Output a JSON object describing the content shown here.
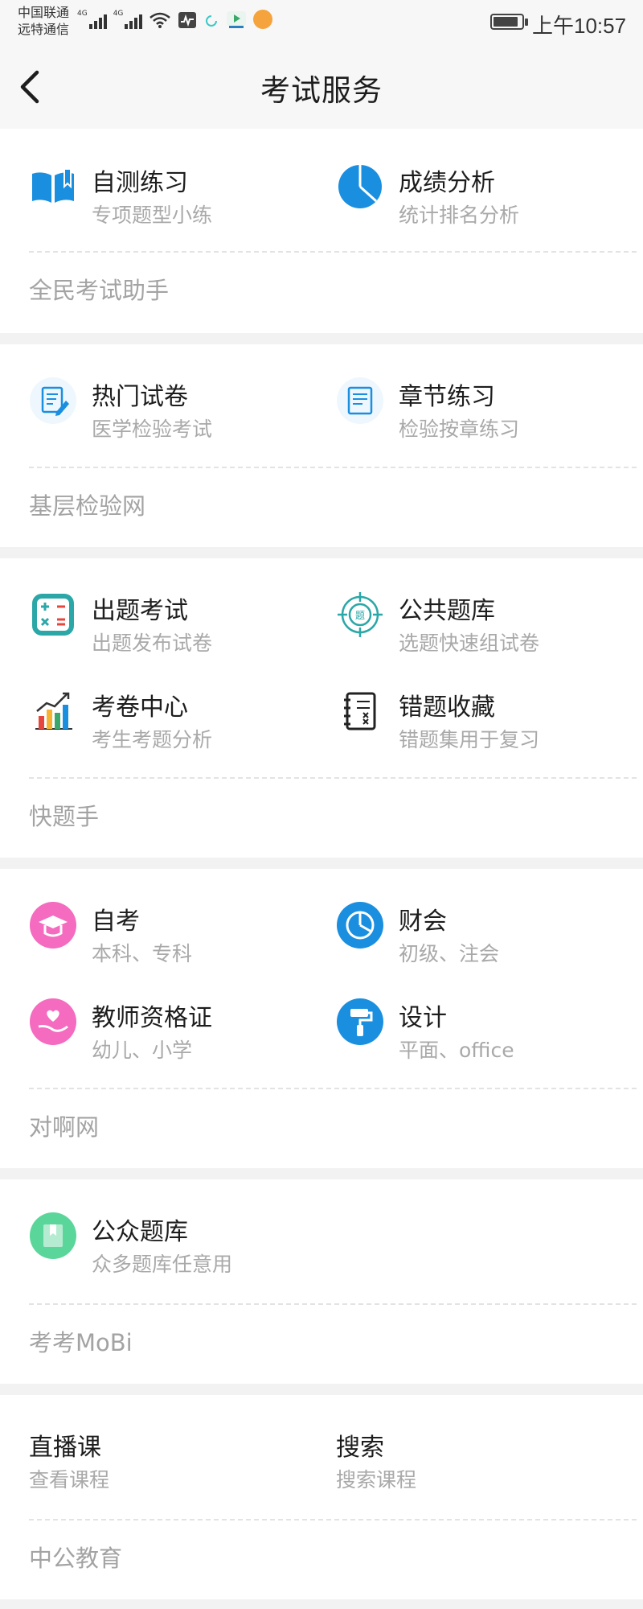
{
  "status_bar": {
    "carrier_line1": "中国联通",
    "carrier_line2": "远特通信",
    "net1": "4G",
    "net2": "4G",
    "time": "上午10:57"
  },
  "header": {
    "title": "考试服务"
  },
  "sections": [
    {
      "items": [
        {
          "title": "自测练习",
          "subtitle": "专项题型小练",
          "icon": "book-icon"
        },
        {
          "title": "成绩分析",
          "subtitle": "统计排名分析",
          "icon": "pie-chart-icon"
        }
      ],
      "provider": "全民考试助手"
    },
    {
      "items": [
        {
          "title": "热门试卷",
          "subtitle": "医学检验考试",
          "icon": "edit-document-icon"
        },
        {
          "title": "章节练习",
          "subtitle": "检验按章练习",
          "icon": "document-icon"
        }
      ],
      "provider": "基层检验网"
    },
    {
      "items": [
        {
          "title": "出题考试",
          "subtitle": "出题发布试卷",
          "icon": "calculator-icon"
        },
        {
          "title": "公共题库",
          "subtitle": "选题快速组试卷",
          "icon": "target-icon"
        },
        {
          "title": "考卷中心",
          "subtitle": "考生考题分析",
          "icon": "bar-chart-icon"
        },
        {
          "title": "错题收藏",
          "subtitle": "错题集用于复习",
          "icon": "notebook-icon"
        }
      ],
      "provider": "快题手"
    },
    {
      "items": [
        {
          "title": "自考",
          "subtitle": "本科、专科",
          "icon": "graduation-cap-icon"
        },
        {
          "title": "财会",
          "subtitle": "初级、注会",
          "icon": "pie-chart-icon"
        },
        {
          "title": "教师资格证",
          "subtitle": "幼儿、小学",
          "icon": "heart-hand-icon"
        },
        {
          "title": "设计",
          "subtitle": "平面、office",
          "icon": "paint-roller-icon"
        }
      ],
      "provider": "对啊网"
    },
    {
      "items": [
        {
          "title": "公众题库",
          "subtitle": "众多题库任意用",
          "icon": "bookmark-icon"
        }
      ],
      "provider": "考考MoBi"
    },
    {
      "items": [
        {
          "title": "直播课",
          "subtitle": "查看课程"
        },
        {
          "title": "搜索",
          "subtitle": "搜索课程"
        }
      ],
      "provider": "中公教育"
    }
  ],
  "colors": {
    "accent_blue": "#1a8fe0",
    "pink": "#f46bbf",
    "green": "#5bd69a",
    "teal": "#2ca7a8"
  }
}
